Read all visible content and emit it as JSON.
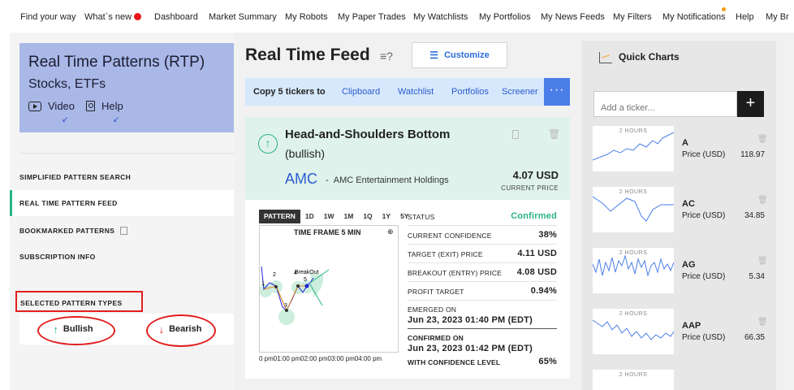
{
  "topnav": {
    "items": [
      "Find your way",
      "What`s new",
      "Dashboard",
      "Market Summary",
      "My Robots",
      "My Paper Trades",
      "My Watchlists",
      "My Portfolios",
      "My News Feeds",
      "My Filters",
      "My Notifications",
      "Help",
      "My Br"
    ]
  },
  "rtp": {
    "title": "Real Time Patterns (RTP)",
    "subtitle": "Stocks, ETFs",
    "video_label": "Video",
    "help_label": "Help"
  },
  "left_menu": {
    "items": [
      "SIMPLIFIED PATTERN SEARCH",
      "REAL TIME PATTERN FEED",
      "BOOKMARKED PATTERNS",
      "SUBSCRIPTION INFO"
    ],
    "selected_types_label": "SELECTED PATTERN TYPES",
    "bullish": "Bullish",
    "bearish": "Bearish"
  },
  "feed": {
    "title": "Real Time Feed",
    "customize": "Customize",
    "copy_label": "Copy 5 tickers to",
    "copy_targets": [
      "Clipboard",
      "Watchlist",
      "Portfolios",
      "Screener"
    ],
    "more": "···"
  },
  "card": {
    "pattern_name": "Head-and-Shoulders Bottom",
    "direction": "(bullish)",
    "ticker": "AMC",
    "company": "AMC Entertainment Holdings",
    "price": "4.07 USD",
    "price_caption": "CURRENT PRICE"
  },
  "detail": {
    "tabs": [
      "PATTERN",
      "1D",
      "1W",
      "1M",
      "1Q",
      "1Y",
      "5Y"
    ],
    "timeframe": "TIME FRAME 5 MIN",
    "chart_labels": {
      "p1": "1",
      "p2": "2",
      "p3": "3",
      "p4": "4",
      "p5": "5",
      "breakout": "BreakOut"
    },
    "xticks": "0 pm01:00 pm02:00 pm03:00 pm04:00 pm",
    "status_label": "STATUS",
    "status_value": "Confirmed",
    "confidence_label": "CURRENT CONFIDENCE",
    "confidence_value": "38%",
    "target_label": "TARGET (EXIT) PRICE",
    "target_value": "4.11 USD",
    "breakout_label": "BREAKOUT (ENTRY) PRICE",
    "breakout_value": "4.08 USD",
    "profit_label": "PROFIT TARGET",
    "profit_value": "0.94%",
    "emerged_label": "EMERGED ON",
    "emerged_value": "Jun 23, 2023 01:40 PM (EDT)",
    "confirmed_label": "CONFIRMED ON",
    "confirmed_value": "Jun 23, 2023 01:42 PM (EDT)",
    "with_conf_label": "WITH CONFIDENCE LEVEL",
    "with_conf_value": "65%"
  },
  "quick_charts": {
    "title": "Quick Charts",
    "placeholder": "Add a ticker...",
    "plus": "+",
    "range_label": "2 HOURS",
    "price_caption": "Price (USD)",
    "items": [
      {
        "symbol": "A",
        "price": "118.97"
      },
      {
        "symbol": "AC",
        "price": "34.85"
      },
      {
        "symbol": "AG",
        "price": "5.34"
      },
      {
        "symbol": "AAP",
        "price": "66.35"
      }
    ]
  },
  "colors": {
    "accent_green": "#2ab38a",
    "accent_blue": "#2a5ccf",
    "annotation_red": "#e21f1f",
    "rtp_card": "#a9b8e7"
  }
}
